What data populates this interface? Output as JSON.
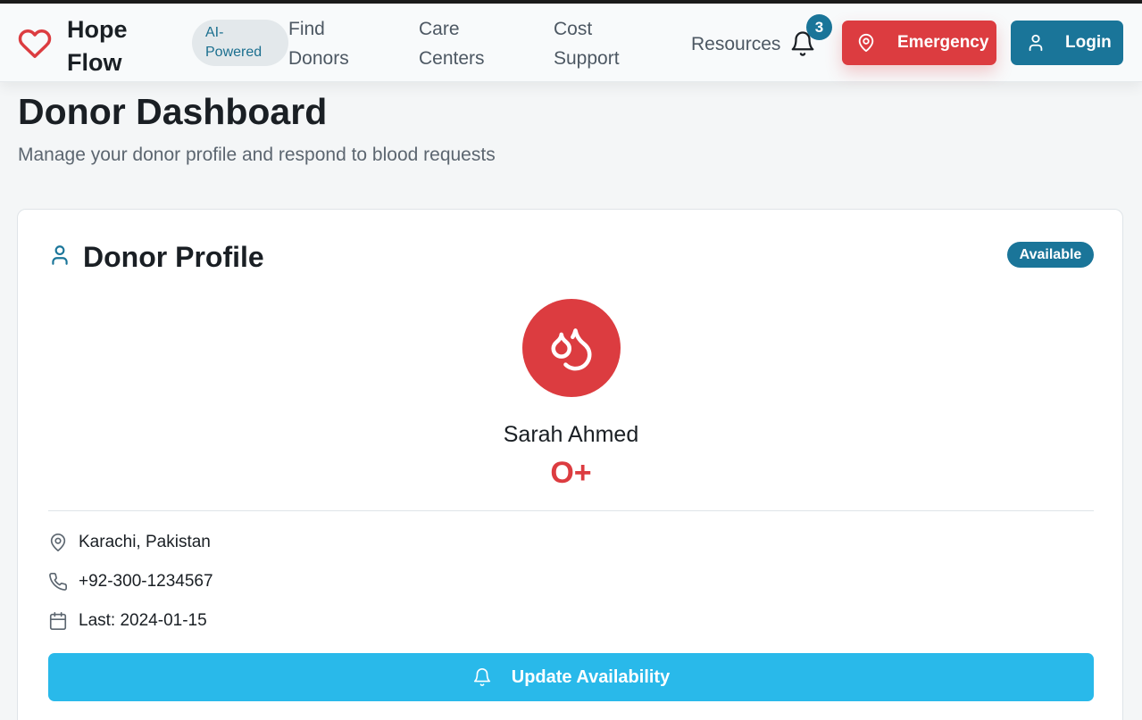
{
  "header": {
    "brand_line1": "Hope",
    "brand_line2": "Flow",
    "ai_badge_line1": "AI-",
    "ai_badge_line2": "Powered",
    "nav": [
      {
        "line1": "Find",
        "line2": "Donors"
      },
      {
        "line1": "Care",
        "line2": "Centers"
      },
      {
        "line1": "Cost",
        "line2": "Support"
      },
      {
        "line1": "Resources"
      }
    ],
    "notification_count": "3",
    "emergency_label": "Emergency",
    "login_label": "Login"
  },
  "page": {
    "title": "Donor Dashboard",
    "subtitle": "Manage your donor profile and respond to blood requests"
  },
  "profile": {
    "title": "Donor Profile",
    "status": "Available",
    "name": "Sarah Ahmed",
    "blood_type": "O+",
    "location": "Karachi, Pakistan",
    "phone": "+92-300-1234567",
    "last_donation": "Last: 2024-01-15",
    "update_button": "Update Availability"
  },
  "colors": {
    "primary": "#1a7599",
    "danger": "#dc3c40",
    "accent": "#29b9ea"
  },
  "icons": {
    "logo": "heart-icon",
    "notifications": "bell-icon",
    "emergency": "map-pin-icon",
    "login": "user-icon",
    "profile": "user-icon",
    "avatar": "blood-drops-icon",
    "location": "map-pin-icon",
    "phone": "phone-icon",
    "date": "calendar-icon",
    "update": "bell-icon"
  }
}
